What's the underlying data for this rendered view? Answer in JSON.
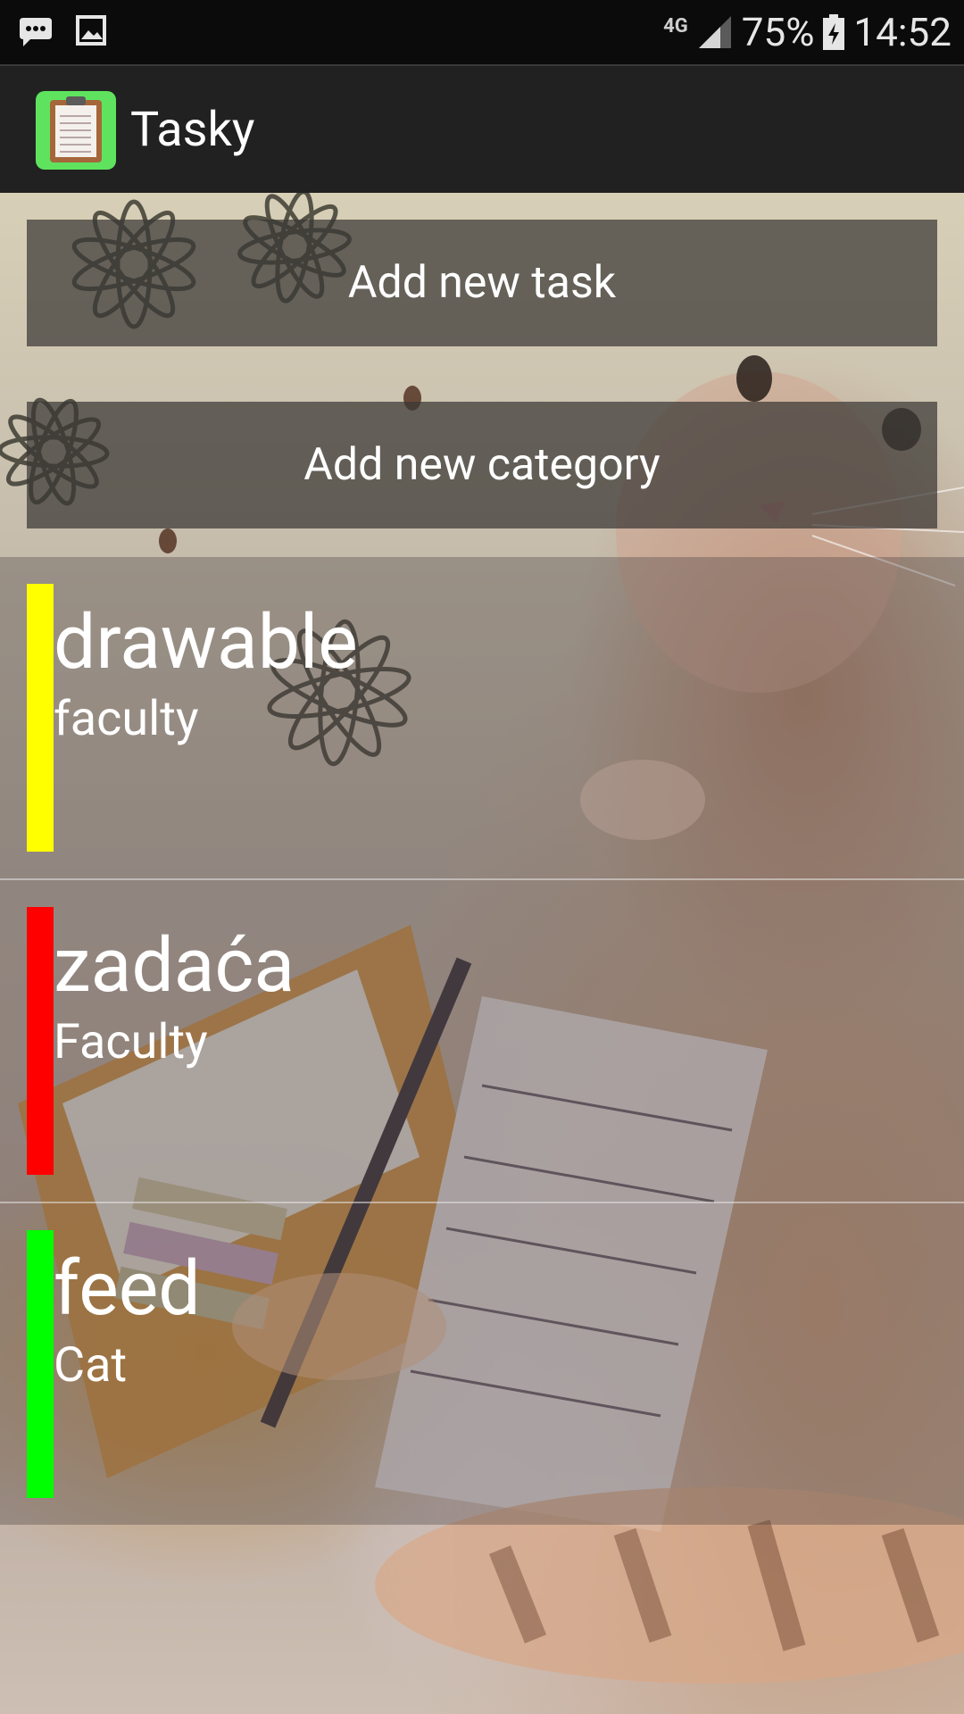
{
  "status_bar": {
    "network_type": "4G",
    "battery_percent": "75%",
    "time": "14:52",
    "icons": [
      "message-icon",
      "image-icon",
      "signal-icon",
      "battery-charging-icon"
    ]
  },
  "app_bar": {
    "title": "Tasky",
    "icon": "clipboard-icon"
  },
  "actions": {
    "add_task_label": "Add new task",
    "add_category_label": "Add new category"
  },
  "tasks": [
    {
      "name": "drawable",
      "category": "faculty",
      "color": "#ffff00"
    },
    {
      "name": "zadaća",
      "category": "Faculty",
      "color": "#ff0000"
    },
    {
      "name": "feed",
      "category": "Cat",
      "color": "#00ff00"
    }
  ]
}
